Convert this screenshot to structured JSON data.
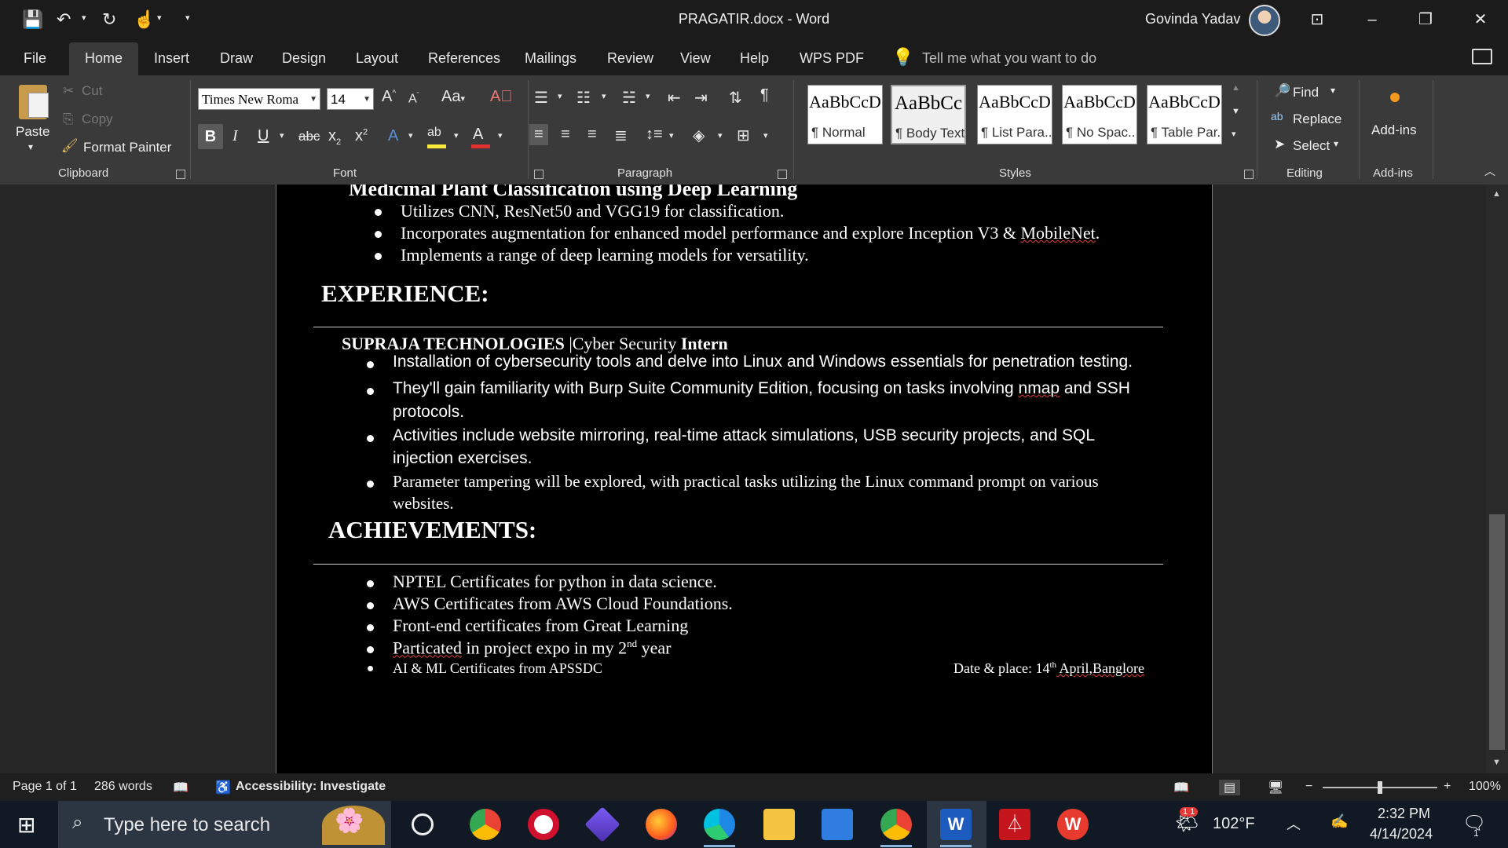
{
  "app": {
    "title": "PRAGATIR.docx  -  Word",
    "user_name": "Govinda Yadav"
  },
  "tabs": [
    "File",
    "Home",
    "Insert",
    "Draw",
    "Design",
    "Layout",
    "References",
    "Mailings",
    "Review",
    "View",
    "Help",
    "WPS PDF"
  ],
  "tell_me": "Tell me what you want to do",
  "ribbon": {
    "clipboard": {
      "paste": "Paste",
      "cut": "Cut",
      "copy": "Copy",
      "format_painter": "Format Painter",
      "label": "Clipboard"
    },
    "font": {
      "name": "Times New Roma",
      "size": "14",
      "label": "Font",
      "case_btn": "Aa"
    },
    "paragraph": {
      "label": "Paragraph"
    },
    "styles": {
      "label": "Styles",
      "items": [
        {
          "sample": "AaBbCcD",
          "name": "¶ Normal"
        },
        {
          "sample": "AaBbCc",
          "name": "¶ Body Text"
        },
        {
          "sample": "AaBbCcD",
          "name": "¶ List Para..."
        },
        {
          "sample": "AaBbCcD",
          "name": "¶ No Spac..."
        },
        {
          "sample": "AaBbCcD",
          "name": "¶ Table Par..."
        }
      ]
    },
    "editing": {
      "find": "Find",
      "replace": "Replace",
      "select": "Select",
      "label": "Editing"
    },
    "addins": {
      "button": "Add-ins",
      "label": "Add-ins"
    }
  },
  "document": {
    "cut_heading": "Medicinal Plant Classification using Deep Learning",
    "project_bullets": [
      "Utilizes CNN, ResNet50 and VGG19 for classification.",
      "Incorporates augmentation for enhanced model performance and explore Inception V3 & ",
      "Implements a range of deep learning models for versatility."
    ],
    "project_bullet2_tail": "MobileNet",
    "experience_heading": "EXPERIENCE:",
    "company": "SUPRAJA TECHNOLOGIES ",
    "role_sep": "|Cyber Security ",
    "role": "Intern",
    "exp_bullets": {
      "b1": " Installation of cybersecurity tools and delve into Linux and Windows essentials for penetration testing.",
      "b2_l1_a": "They'll gain familiarity with Burp Suite Community Edition, focusing on tasks involving ",
      "b2_l1_nmap": "nmap",
      "b2_l1_b": " and SSH",
      "b2_l2": "protocols.",
      "b3_l1": "Activities include website mirroring, real-time attack simulations, USB security projects, and SQL",
      "b3_l2": "injection exercises.",
      "b4_l1": "Parameter tampering will be explored, with practical tasks utilizing the Linux command prompt on various",
      "b4_l2": "websites."
    },
    "achievements_heading": "ACHIEVEMENTS:",
    "achievements": {
      "a1": " NPTEL Certificates for python in data science.",
      "a2": "AWS Certificates from AWS Cloud Foundations.",
      "a3": "Front-end certificates from Great Learning",
      "a4_word": "Particated",
      "a4_rest": " in project expo in my 2",
      "a4_sup": "nd",
      "a4_end": " year",
      "a5": "AI & ML Certificates from APSSDC"
    },
    "date_place": {
      "label": "Date & place:  14",
      "sup": "th",
      "rest": " April,Banglore"
    }
  },
  "status": {
    "page": "Page 1 of 1",
    "words": "286 words",
    "accessibility": "Accessibility: Investigate",
    "zoom": "100%",
    "zoom_level_fraction": 0.5
  },
  "taskbar": {
    "search_placeholder": "Type here to search",
    "temperature": "102°F",
    "time": "2:32 PM",
    "date": "4/14/2024",
    "weather_badge": "1 1",
    "notification_count": "1"
  },
  "colors": {
    "title_bg": "#1b1b1b",
    "ribbon_bg": "#3a3a3a",
    "doc_bg": "#262626",
    "page_bg": "#000000",
    "spell_error": "#e04040",
    "highlight": "#f7e83a",
    "font_color": "#e03030"
  }
}
